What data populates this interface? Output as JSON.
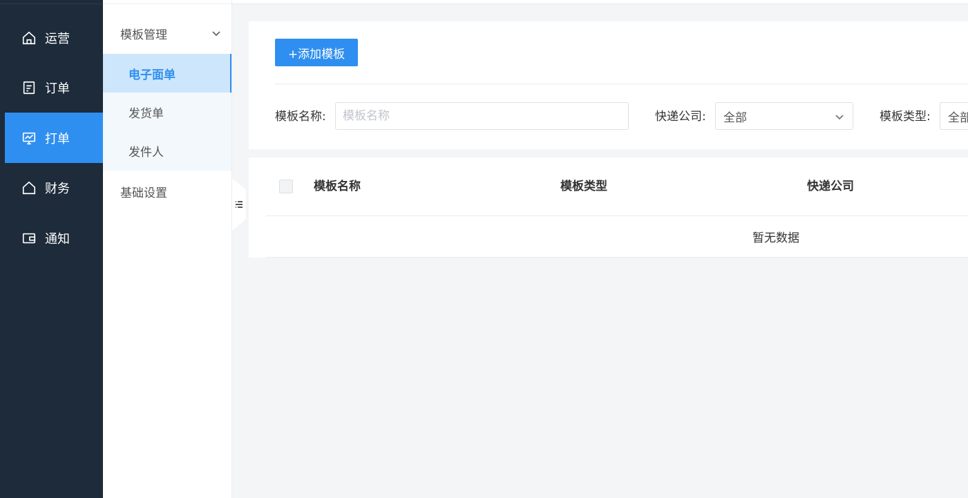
{
  "nav": {
    "items": [
      {
        "label": "运营",
        "icon": "home-icon",
        "active": false
      },
      {
        "label": "订单",
        "icon": "document-icon",
        "active": false
      },
      {
        "label": "打单",
        "icon": "monitor-icon",
        "active": true
      },
      {
        "label": "财务",
        "icon": "home-icon",
        "active": false
      },
      {
        "label": "通知",
        "icon": "wallet-icon",
        "active": false
      }
    ]
  },
  "subnav": {
    "group1": {
      "label": "模板管理",
      "expanded": true
    },
    "items": [
      {
        "label": "电子面单",
        "active": true
      },
      {
        "label": "发货单",
        "active": false
      },
      {
        "label": "发件人",
        "active": false
      }
    ],
    "group2": {
      "label": "基础设置"
    }
  },
  "toolbar": {
    "add_label": "+添加模板"
  },
  "filters": {
    "name_label": "模板名称:",
    "name_placeholder": "模板名称",
    "courier_label": "快递公司:",
    "courier_value": "全部",
    "type_label": "模板类型:",
    "type_value": "全部"
  },
  "table": {
    "columns": [
      "模板名称",
      "模板类型",
      "快递公司"
    ],
    "empty_text": "暂无数据"
  },
  "colors": {
    "sidebar_bg": "#1d2b3a",
    "accent": "#2f8ff0",
    "active_sub_bg": "#cde6fb",
    "page_bg": "#f4f5f7"
  }
}
